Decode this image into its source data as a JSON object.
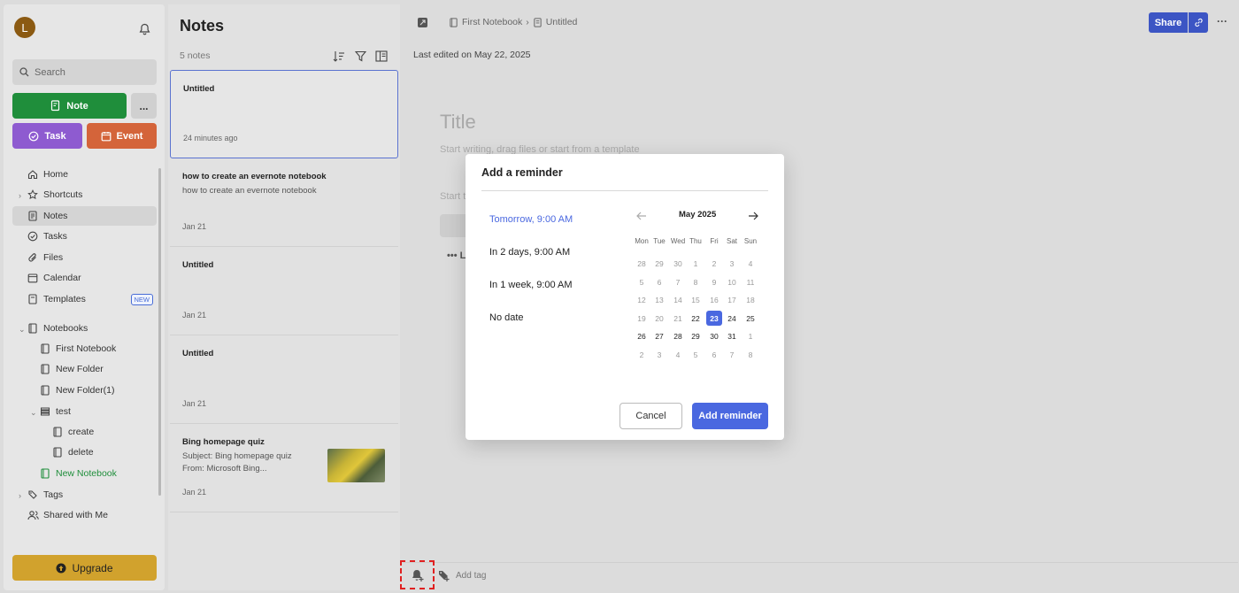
{
  "sidebar": {
    "avatar_letter": "L",
    "search_placeholder": "Search",
    "note_label": "Note",
    "more_label": "...",
    "task_label": "Task",
    "event_label": "Event",
    "items": [
      {
        "label": "Home",
        "icon": "home-icon"
      },
      {
        "label": "Shortcuts",
        "icon": "star-icon"
      },
      {
        "label": "Notes",
        "icon": "notes-icon"
      },
      {
        "label": "Tasks",
        "icon": "task-check-icon"
      },
      {
        "label": "Files",
        "icon": "paperclip-icon"
      },
      {
        "label": "Calendar",
        "icon": "calendar-icon"
      },
      {
        "label": "Templates",
        "icon": "template-icon",
        "badge": "NEW"
      },
      {
        "label": "Notebooks",
        "icon": "notebook-icon"
      },
      {
        "label": "First Notebook",
        "icon": "notebook-icon"
      },
      {
        "label": "New Folder",
        "icon": "notebook-icon"
      },
      {
        "label": "New Folder(1)",
        "icon": "notebook-icon"
      },
      {
        "label": "test",
        "icon": "stack-icon"
      },
      {
        "label": "create",
        "icon": "notebook-icon"
      },
      {
        "label": "delete",
        "icon": "notebook-icon"
      },
      {
        "label": "New Notebook",
        "icon": "notebook-icon"
      },
      {
        "label": "Tags",
        "icon": "tag-icon"
      },
      {
        "label": "Shared with Me",
        "icon": "people-icon"
      }
    ],
    "upgrade_label": "Upgrade"
  },
  "notes_list": {
    "title": "Notes",
    "count": "5 notes",
    "cards": [
      {
        "title": "Untitled",
        "snippet": "",
        "date": "24 minutes ago"
      },
      {
        "title": "how to create an evernote notebook",
        "snippet": "how to create an evernote notebook",
        "date": "Jan 21"
      },
      {
        "title": "Untitled",
        "snippet": "",
        "date": "Jan 21"
      },
      {
        "title": "Untitled",
        "snippet": "",
        "date": "Jan 21"
      },
      {
        "title": "Bing homepage quiz",
        "snippet": "Subject: Bing homepage quiz",
        "snippet2": "From: Microsoft Bing...",
        "date": "Jan 21"
      }
    ]
  },
  "editor": {
    "breadcrumb_notebook": "First Notebook",
    "breadcrumb_note": "Untitled",
    "share_label": "Share",
    "more_label": "···",
    "last_edited": "Last edited on May 22, 2025",
    "title_placeholder": "Title",
    "body_placeholder": "Start writing, drag files or start from a template",
    "start_text": "Start t",
    "dots_text": "•••  L",
    "add_tag": "Add tag"
  },
  "reminder_modal": {
    "title": "Add a reminder",
    "options": [
      "Tomorrow, 9:00 AM",
      "In 2 days, 9:00 AM",
      "In 1 week, 9:00 AM",
      "No date"
    ],
    "selected_option": "Tomorrow, 9:00 AM",
    "calendar": {
      "month": "May 2025",
      "weekdays": [
        "Mon",
        "Tue",
        "Wed",
        "Thu",
        "Fri",
        "Sat",
        "Sun"
      ],
      "weeks": [
        [
          "28",
          "29",
          "30",
          "1",
          "2",
          "3",
          "4"
        ],
        [
          "5",
          "6",
          "7",
          "8",
          "9",
          "10",
          "11"
        ],
        [
          "12",
          "13",
          "14",
          "15",
          "16",
          "17",
          "18"
        ],
        [
          "19",
          "20",
          "21",
          "22",
          "23",
          "24",
          "25"
        ],
        [
          "26",
          "27",
          "28",
          "29",
          "30",
          "31",
          "1"
        ],
        [
          "2",
          "3",
          "4",
          "5",
          "6",
          "7",
          "8"
        ]
      ],
      "selected_day": "23"
    },
    "cancel_label": "Cancel",
    "add_label": "Add reminder"
  },
  "colors": {
    "accent": "#4a68e0",
    "note_button": "#1f8e3b",
    "task_button": "#8e5bd0",
    "event_button": "#d4643a",
    "upgrade_button": "#d1a22d",
    "share_button": "#3c55c4"
  }
}
